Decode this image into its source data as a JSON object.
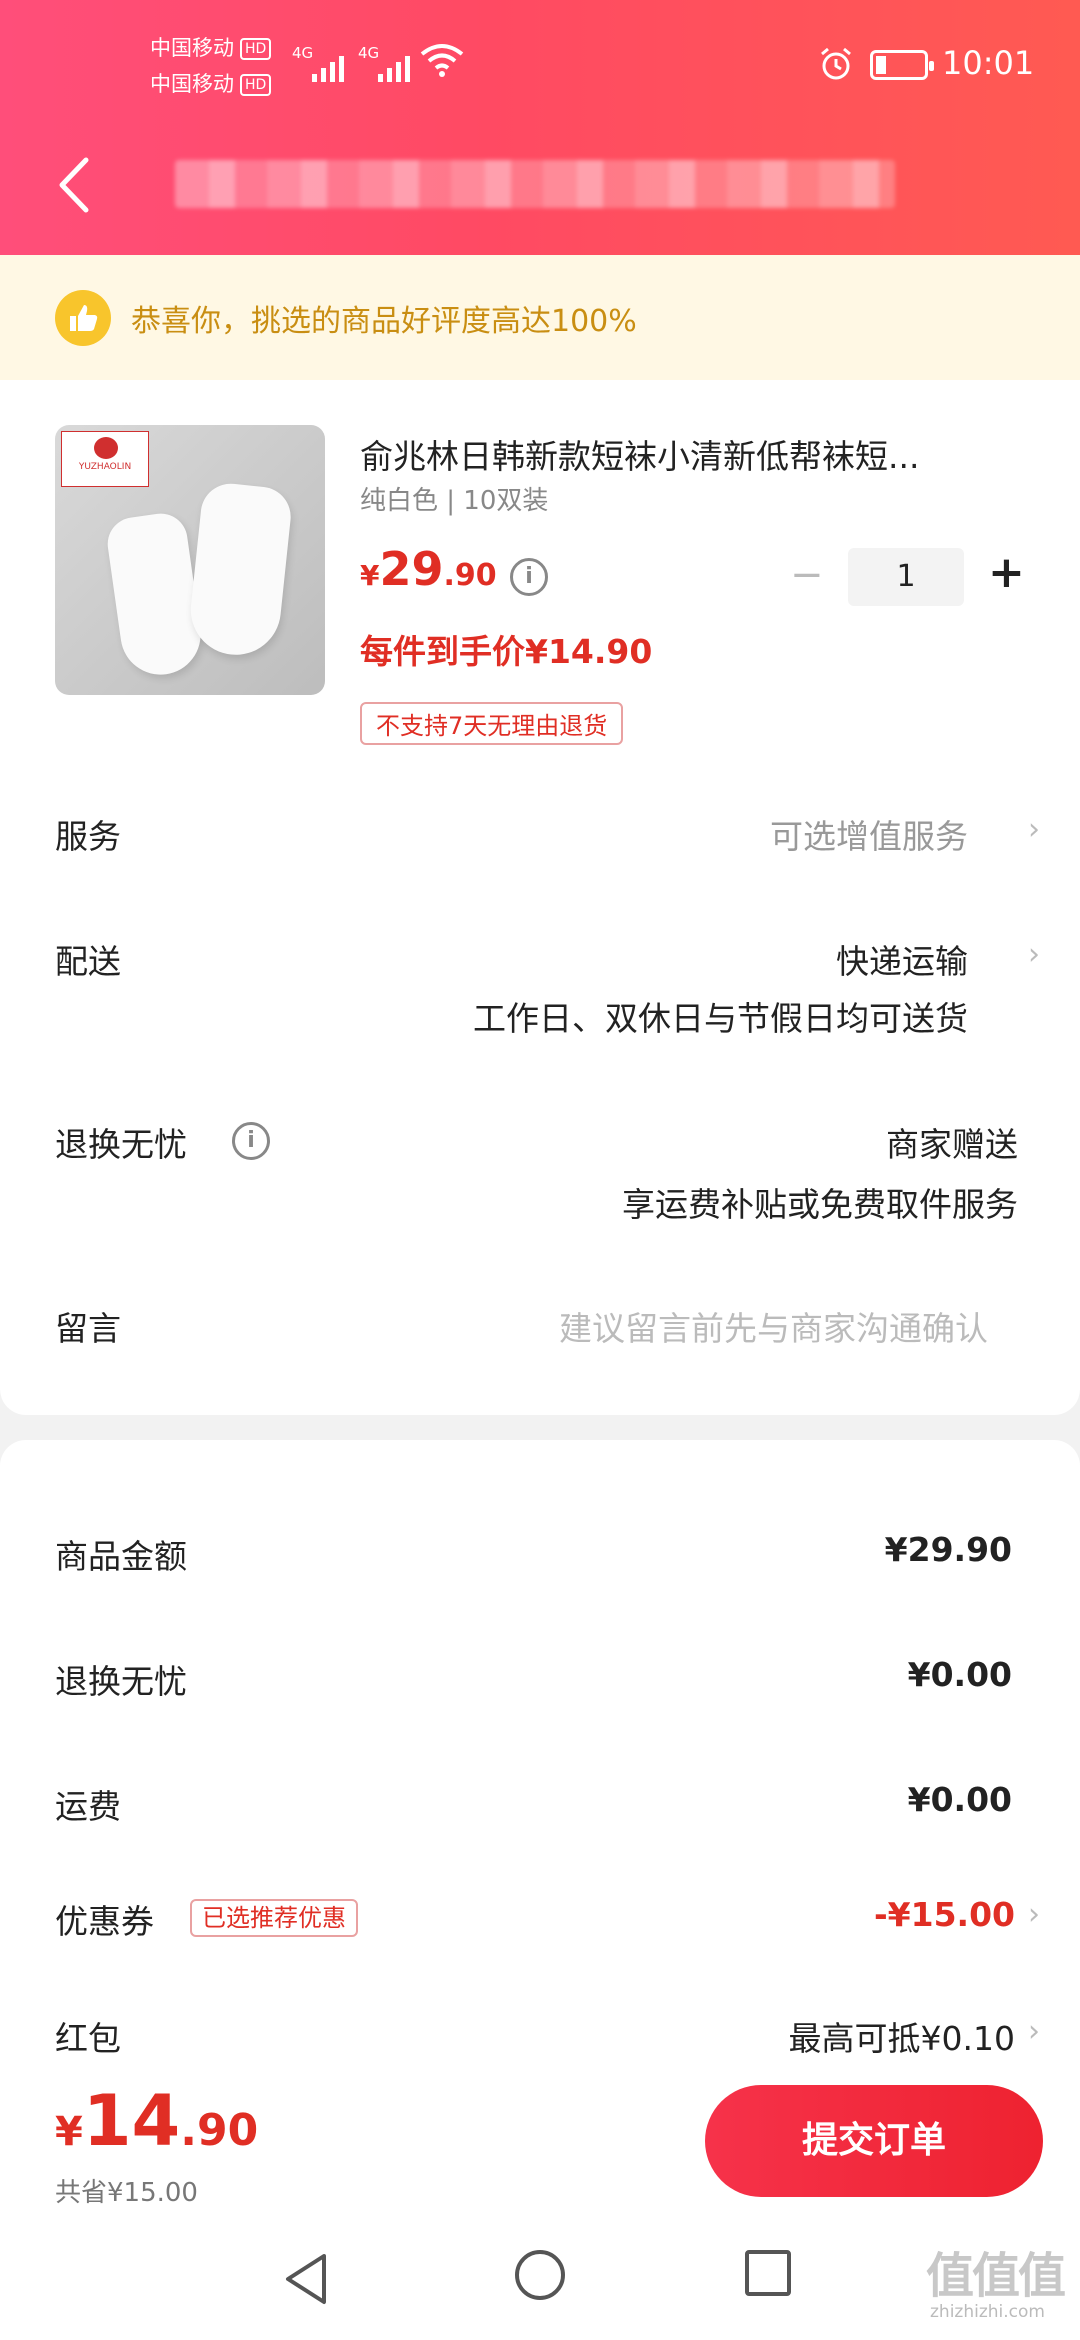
{
  "status_bar": {
    "carrier1": "中国移动",
    "carrier2": "中国移动",
    "hd": "HD",
    "signal1": "4G",
    "signal2": "4G",
    "time": "10:01"
  },
  "congrats": {
    "text": "恭喜你，挑选的商品好评度高达100%"
  },
  "product": {
    "title": "俞兆林日韩新款短袜小清新低帮袜短...",
    "spec": "纯白色 | 10双装",
    "price_yen": "¥",
    "price_int": "29",
    "price_dec": ".90",
    "quantity": "1",
    "each_price": "每件到手价¥14.90",
    "no_return": "不支持7天无理由退货",
    "brand_text": "YUZHAOLIN",
    "minus": "−",
    "plus": "+"
  },
  "rows": {
    "service_label": "服务",
    "service_value": "可选增值服务",
    "delivery_label": "配送",
    "delivery_value": "快递运输",
    "delivery_sub": "工作日、双休日与节假日均可送货",
    "return_label": "退换无忧",
    "return_value": "商家赠送",
    "return_sub": "享运费补贴或免费取件服务",
    "message_label": "留言",
    "message_placeholder": "建议留言前先与商家沟通确认"
  },
  "summary": {
    "items": [
      {
        "label": "商品金额",
        "value": "¥29.90"
      },
      {
        "label": "退换无忧",
        "value": "¥0.00"
      },
      {
        "label": "运费",
        "value": "¥0.00"
      },
      {
        "label": "优惠券",
        "value": "-¥15.00",
        "badge": "已选推荐优惠"
      },
      {
        "label": "红包",
        "value": "最高可抵¥0.10"
      }
    ]
  },
  "bottom": {
    "total_yen": "¥",
    "total_int": "14",
    "total_dec": ".90",
    "saved": "共省¥15.00",
    "submit": "提交订单"
  },
  "watermark": {
    "big": "值值值",
    "small": "zhizhizhi.com"
  },
  "colors": {
    "accent_red": "#e02e24",
    "header_pink": "#ff4e7a",
    "congrats_bg": "#fff8e4"
  }
}
